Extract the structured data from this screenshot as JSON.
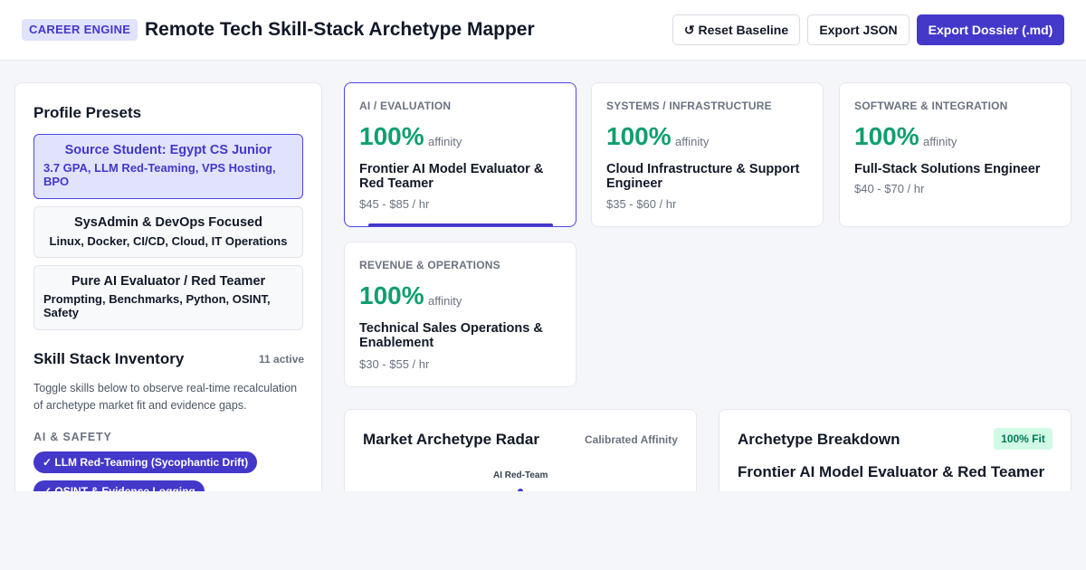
{
  "header": {
    "badge": "CAREER ENGINE",
    "title": "Remote Tech Skill-Stack Archetype Mapper",
    "reset_label": "↺ Reset Baseline",
    "export_json_label": "Export JSON",
    "export_dossier_label": "Export Dossier (.md)"
  },
  "sidebar": {
    "presets_heading": "Profile Presets",
    "presets": [
      {
        "title": "Source Student: Egypt CS Junior",
        "subtitle": "3.7 GPA, LLM Red-Teaming, VPS Hosting, BPO",
        "active": true
      },
      {
        "title": "SysAdmin & DevOps Focused",
        "subtitle": "Linux, Docker, CI/CD, Cloud, IT Operations",
        "active": false
      },
      {
        "title": "Pure AI Evaluator / Red Teamer",
        "subtitle": "Prompting, Benchmarks, Python, OSINT, Safety",
        "active": false
      }
    ],
    "inventory_heading": "Skill Stack Inventory",
    "active_count": "11 active",
    "description": "Toggle skills below to observe real-time recalculation of archetype market fit and evidence gaps.",
    "category_label": "AI & SAFETY",
    "skills": [
      "✓ LLM Red-Teaming (Sycophantic Drift)",
      "✓ OSINT & Evidence Logging"
    ]
  },
  "archetypes": [
    {
      "category": "AI / EVALUATION",
      "percent": "100%",
      "affinity_label": "affinity",
      "title": "Frontier AI Model Evaluator & Red Teamer",
      "rate": "$45 - $85 / hr",
      "selected": true
    },
    {
      "category": "SYSTEMS / INFRASTRUCTURE",
      "percent": "100%",
      "affinity_label": "affinity",
      "title": "Cloud Infrastructure & Support Engineer",
      "rate": "$35 - $60 / hr",
      "selected": false
    },
    {
      "category": "SOFTWARE & INTEGRATION",
      "percent": "100%",
      "affinity_label": "affinity",
      "title": "Full-Stack Solutions Engineer",
      "rate": "$40 - $70 / hr",
      "selected": false
    },
    {
      "category": "REVENUE & OPERATIONS",
      "percent": "100%",
      "affinity_label": "affinity",
      "title": "Technical Sales Operations & Enablement",
      "rate": "$30 - $55 / hr",
      "selected": false
    }
  ],
  "radar": {
    "title": "Market Archetype Radar",
    "note": "Calibrated Affinity",
    "axis_top_label": "AI Red-Team"
  },
  "breakdown": {
    "title": "Archetype Breakdown",
    "fit_badge": "100% Fit",
    "archetype_name": "Frontier AI Model Evaluator & Red Teamer"
  },
  "colors": {
    "accent": "#4338ca",
    "affinity_green": "#0e9f6e",
    "page_bg": "#f5f6fa"
  }
}
